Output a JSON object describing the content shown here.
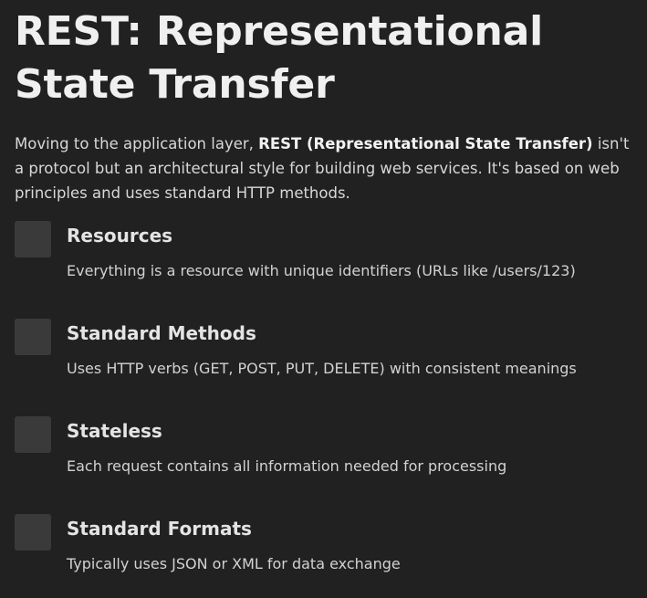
{
  "heading": "REST: Representational State Transfer",
  "intro": {
    "before": "Moving to the application layer, ",
    "bold": "REST (Representational State Transfer)",
    "after": " isn't a protocol but an architectural style for building web services. It's based on web principles and uses standard HTTP methods."
  },
  "features": [
    {
      "title": "Resources",
      "description": "Everything is a resource with unique identifiers (URLs like /users/123)"
    },
    {
      "title": "Standard Methods",
      "description": "Uses HTTP verbs (GET, POST, PUT, DELETE) with consistent meanings"
    },
    {
      "title": "Stateless",
      "description": "Each request contains all information needed for processing"
    },
    {
      "title": "Standard Formats",
      "description": "Typically uses JSON or XML for data exchange"
    }
  ]
}
